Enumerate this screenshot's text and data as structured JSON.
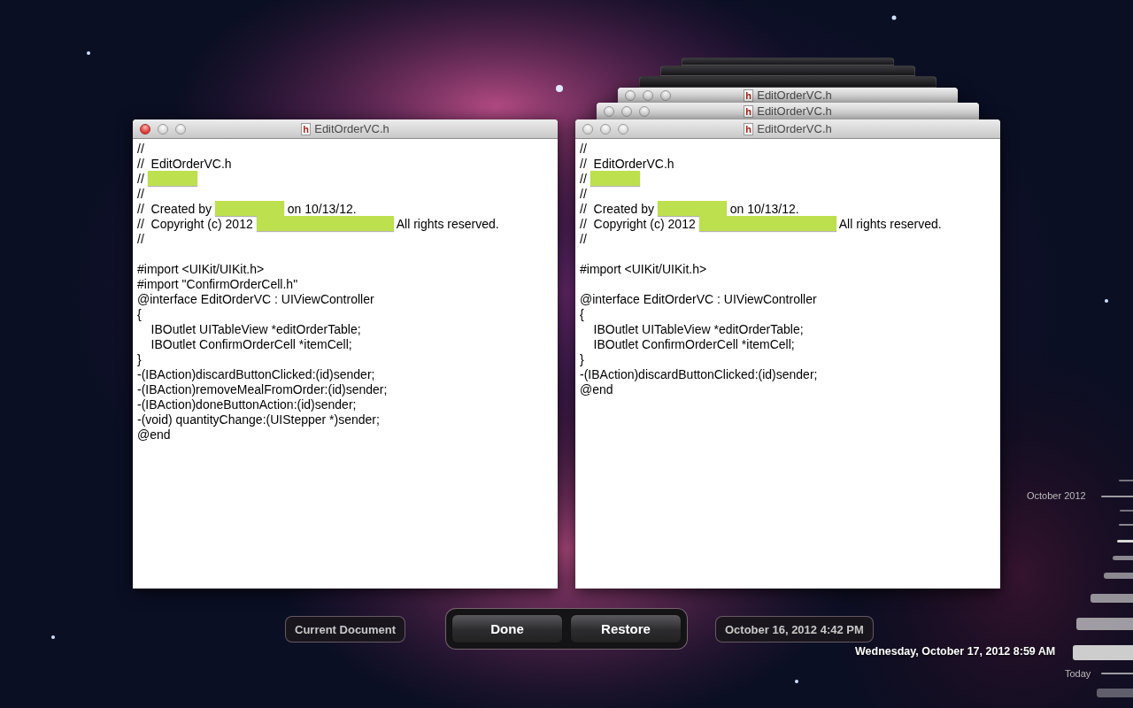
{
  "stacked_windows": [
    {
      "title": "EditOrderVC.h",
      "icon_text": "h",
      "active": false
    },
    {
      "title": "EditOrderVC.h",
      "icon_text": "h",
      "active": false
    }
  ],
  "windows": [
    {
      "title": "EditOrderVC.h",
      "icon_text": "h",
      "active": true,
      "lines": [
        {
          "kind": "code",
          "text": "//"
        },
        {
          "kind": "code",
          "text": "//  EditOrderVC.h"
        },
        {
          "kind": "mixed",
          "parts": [
            {
              "kind": "text",
              "text": "// "
            },
            {
              "kind": "redacted"
            }
          ]
        },
        {
          "kind": "code",
          "text": "//"
        },
        {
          "kind": "mixed",
          "parts": [
            {
              "kind": "text",
              "text": "//  Created by "
            },
            {
              "kind": "redacted"
            },
            {
              "kind": "text",
              "text": " on 10/13/12."
            }
          ]
        },
        {
          "kind": "mixed",
          "parts": [
            {
              "kind": "text",
              "text": "//  Copyright (c) 2012 "
            },
            {
              "kind": "redacted"
            },
            {
              "kind": "text",
              "text": " All rights reserved."
            }
          ]
        },
        {
          "kind": "code",
          "text": "//"
        },
        {
          "kind": "blank"
        },
        {
          "kind": "code",
          "text": "#import <UIKit/UIKit.h>"
        },
        {
          "kind": "code",
          "text": "#import \"ConfirmOrderCell.h\""
        },
        {
          "kind": "code",
          "text": "@interface EditOrderVC : UIViewController"
        },
        {
          "kind": "code",
          "text": "{"
        },
        {
          "kind": "code",
          "text": "    IBOutlet UITableView *editOrderTable;"
        },
        {
          "kind": "code",
          "text": "    IBOutlet ConfirmOrderCell *itemCell;"
        },
        {
          "kind": "code",
          "text": "}"
        },
        {
          "kind": "code",
          "text": "-(IBAction)discardButtonClicked:(id)sender;"
        },
        {
          "kind": "code",
          "text": "-(IBAction)removeMealFromOrder:(id)sender;"
        },
        {
          "kind": "code",
          "text": "-(IBAction)doneButtonAction:(id)sender;"
        },
        {
          "kind": "code",
          "text": "-(void) quantityChange:(UIStepper *)sender;"
        },
        {
          "kind": "code",
          "text": "@end"
        }
      ]
    },
    {
      "title": "EditOrderVC.h",
      "icon_text": "h",
      "active": false,
      "lines": [
        {
          "kind": "code",
          "text": "//"
        },
        {
          "kind": "code",
          "text": "//  EditOrderVC.h"
        },
        {
          "kind": "mixed",
          "parts": [
            {
              "kind": "text",
              "text": "// "
            },
            {
              "kind": "redacted"
            }
          ]
        },
        {
          "kind": "code",
          "text": "//"
        },
        {
          "kind": "mixed",
          "parts": [
            {
              "kind": "text",
              "text": "//  Created by "
            },
            {
              "kind": "redacted"
            },
            {
              "kind": "text",
              "text": " on 10/13/12."
            }
          ]
        },
        {
          "kind": "mixed",
          "parts": [
            {
              "kind": "text",
              "text": "//  Copyright (c) 2012 "
            },
            {
              "kind": "redacted"
            },
            {
              "kind": "text",
              "text": " All rights reserved."
            }
          ]
        },
        {
          "kind": "code",
          "text": "//"
        },
        {
          "kind": "blank"
        },
        {
          "kind": "code",
          "text": "#import <UIKit/UIKit.h>"
        },
        {
          "kind": "blank"
        },
        {
          "kind": "code",
          "text": "@interface EditOrderVC : UIViewController"
        },
        {
          "kind": "code",
          "text": "{"
        },
        {
          "kind": "code",
          "text": "    IBOutlet UITableView *editOrderTable;"
        },
        {
          "kind": "code",
          "text": "    IBOutlet ConfirmOrderCell *itemCell;"
        },
        {
          "kind": "code",
          "text": "}"
        },
        {
          "kind": "code",
          "text": "-(IBAction)discardButtonClicked:(id)sender;"
        },
        {
          "kind": "code",
          "text": "@end"
        }
      ]
    }
  ],
  "controls": {
    "current_button": "Current Document",
    "done_button": "Done",
    "restore_button": "Restore",
    "version_button": "October 16, 2012 4:42 PM"
  },
  "timeline": {
    "month_label": "October 2012",
    "current_date": "Wednesday, October 17, 2012 8:59 AM",
    "today_label": "Today"
  }
}
